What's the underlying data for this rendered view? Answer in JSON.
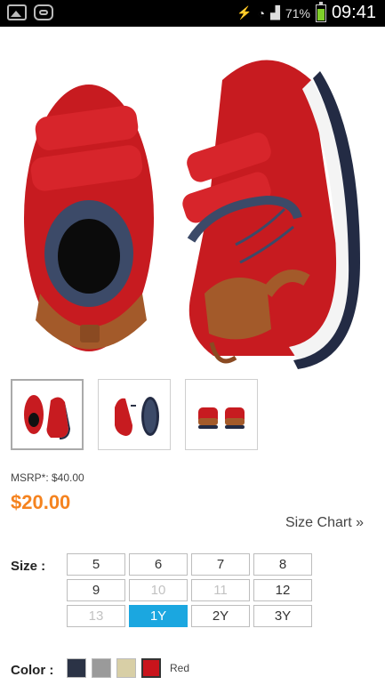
{
  "status_bar": {
    "battery_percent": "71%",
    "time": "09:41",
    "battery_level": 0.71
  },
  "product": {
    "msrp": "MSRP*: $40.00",
    "price": "$20.00",
    "size_chart_link": "Size Chart »"
  },
  "sizes": {
    "label": "Size :",
    "options": [
      {
        "label": "5",
        "state": "normal"
      },
      {
        "label": "6",
        "state": "normal"
      },
      {
        "label": "7",
        "state": "normal"
      },
      {
        "label": "8",
        "state": "normal"
      },
      {
        "label": "9",
        "state": "normal"
      },
      {
        "label": "10",
        "state": "disabled"
      },
      {
        "label": "11",
        "state": "disabled"
      },
      {
        "label": "12",
        "state": "normal"
      },
      {
        "label": "13",
        "state": "disabled"
      },
      {
        "label": "1Y",
        "state": "selected"
      },
      {
        "label": "2Y",
        "state": "normal"
      },
      {
        "label": "3Y",
        "state": "normal"
      }
    ]
  },
  "colors": {
    "label": "Color :",
    "selected_name": "Red",
    "swatches": [
      {
        "name": "navy",
        "hex": "#2b3346"
      },
      {
        "name": "gray",
        "hex": "#9a9a9a"
      },
      {
        "name": "tan",
        "hex": "#d8cfa6"
      },
      {
        "name": "red",
        "hex": "#c9141c",
        "selected": true
      }
    ]
  },
  "thumbnails": [
    "thumb-pair-front",
    "thumb-pair-side",
    "thumb-pair-back"
  ]
}
